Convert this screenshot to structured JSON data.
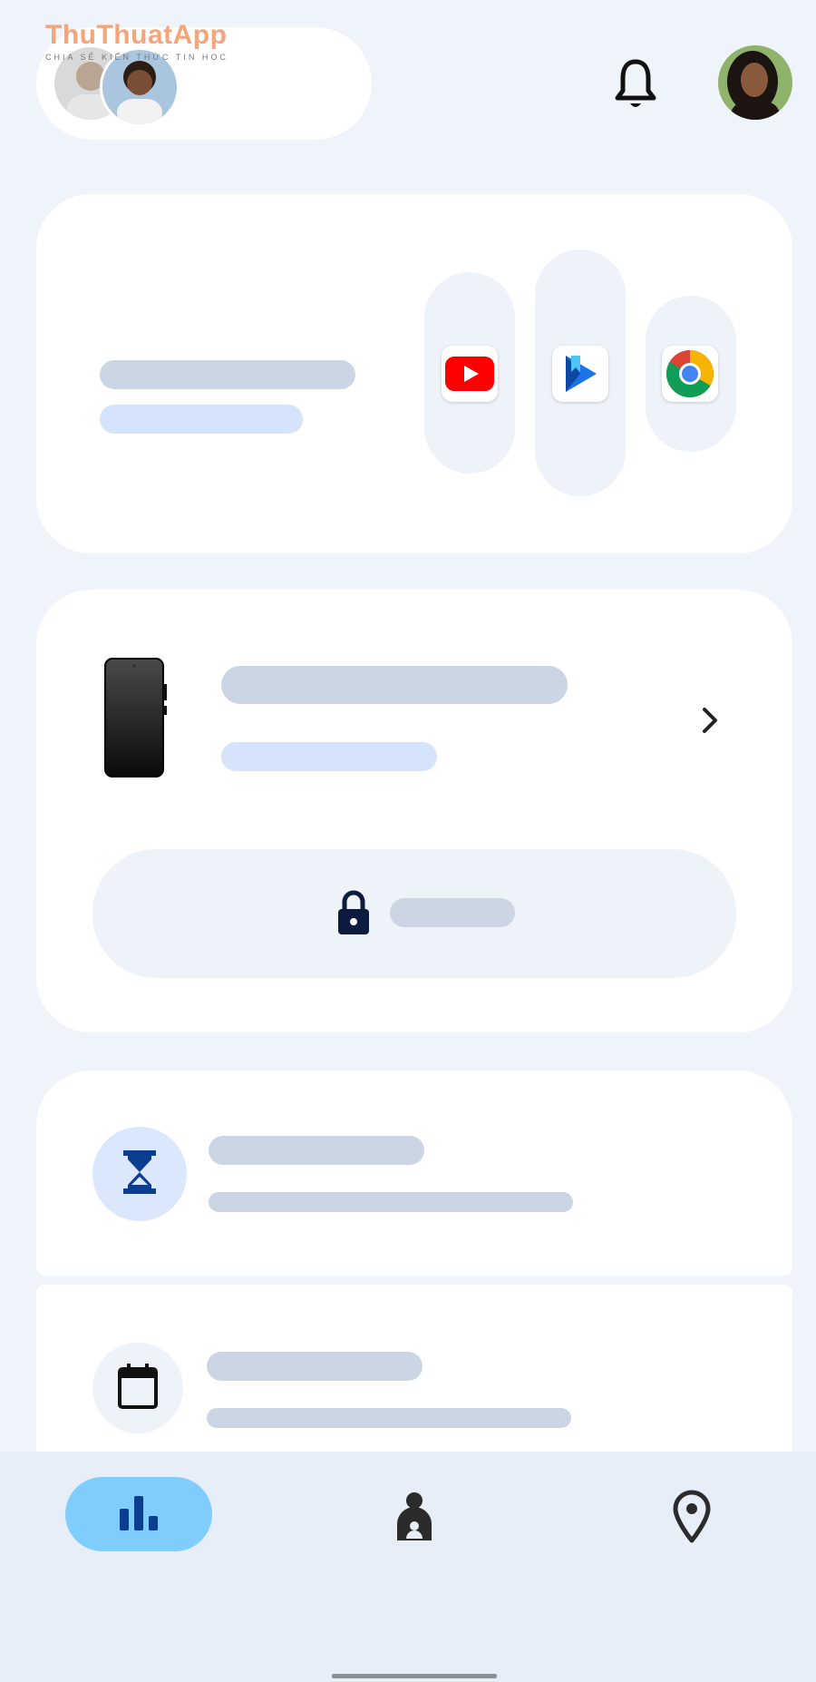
{
  "watermark": {
    "brand": "ThuThuatApp",
    "tagline": "CHIA SẺ KIẾN THỨC TIN HỌC"
  },
  "header": {
    "profiles": [
      "avatar-child-1",
      "avatar-child-2"
    ],
    "notification_icon": "bell-icon",
    "account_avatar": "avatar-parent"
  },
  "apps_card": {
    "apps": [
      {
        "icon": "youtube-icon",
        "color": "#ff0000"
      },
      {
        "icon": "google-play-books-icon",
        "color": "#1a73e8"
      },
      {
        "icon": "chrome-icon",
        "color": "#4285f4"
      }
    ]
  },
  "device_card": {
    "device_icon": "phone-icon",
    "chevron": "chevron-right-icon",
    "lock_icon": "lock-icon"
  },
  "screen_time_card": {
    "icon": "hourglass-icon",
    "accent": "#0b3d91",
    "icon_bg": "#dbe7fc"
  },
  "schedule_card": {
    "icon": "calendar-icon",
    "icon_bg": "#eef2f9"
  },
  "bottom_nav": {
    "items": [
      {
        "icon": "bar-chart-icon",
        "active": true
      },
      {
        "icon": "person-icon",
        "active": false
      },
      {
        "icon": "location-pin-icon",
        "active": false
      }
    ],
    "active_color": "#7fcdfd"
  }
}
